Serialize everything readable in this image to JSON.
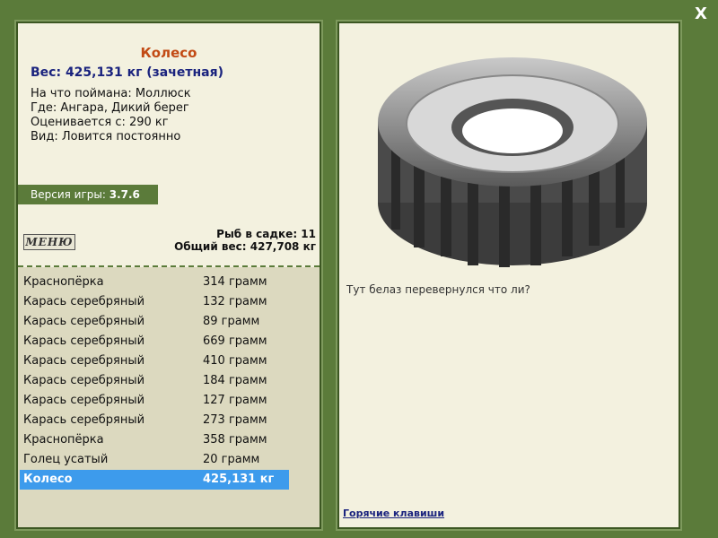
{
  "close_label": "X",
  "fish": {
    "title": "Колесо",
    "weight": "Вес: 425,131 кг (зачетная)",
    "caught_on": "На что поймана: Моллюск",
    "location": "Где: Ангара, Дикий берег",
    "valued_from": "Оценивается с: 290 кг",
    "type": "Вид: Ловится постоянно",
    "description": "Тут белаз перевернулся что ли?"
  },
  "version": {
    "label": "Версия игры:",
    "value": "3.7.6"
  },
  "menu_label": "МЕНЮ",
  "stats": {
    "fish_count": "Рыб в садке: 11",
    "total_weight": "Общий вес: 427,708 кг"
  },
  "catch_list": [
    {
      "name": "Краснопёрка",
      "weight": "314 грамм"
    },
    {
      "name": "Карась серебряный",
      "weight": "132 грамм"
    },
    {
      "name": "Карась серебряный",
      "weight": "89 грамм"
    },
    {
      "name": "Карась серебряный",
      "weight": "669 грамм"
    },
    {
      "name": "Карась серебряный",
      "weight": "410 грамм"
    },
    {
      "name": "Карась серебряный",
      "weight": "184 грамм"
    },
    {
      "name": "Карась серебряный",
      "weight": "127 грамм"
    },
    {
      "name": "Карась серебряный",
      "weight": "273 грамм"
    },
    {
      "name": "Краснопёрка",
      "weight": "358 грамм"
    },
    {
      "name": "Голец усатый",
      "weight": "20 грамм"
    },
    {
      "name": "Колесо",
      "weight": "425,131 кг"
    }
  ],
  "selected_index": 10,
  "hotkeys_label": "Горячие клавиши",
  "colors": {
    "background": "#5b7b3a",
    "panel": "#f3f1df",
    "selected": "#3d9bec",
    "title": "#c24a14"
  }
}
